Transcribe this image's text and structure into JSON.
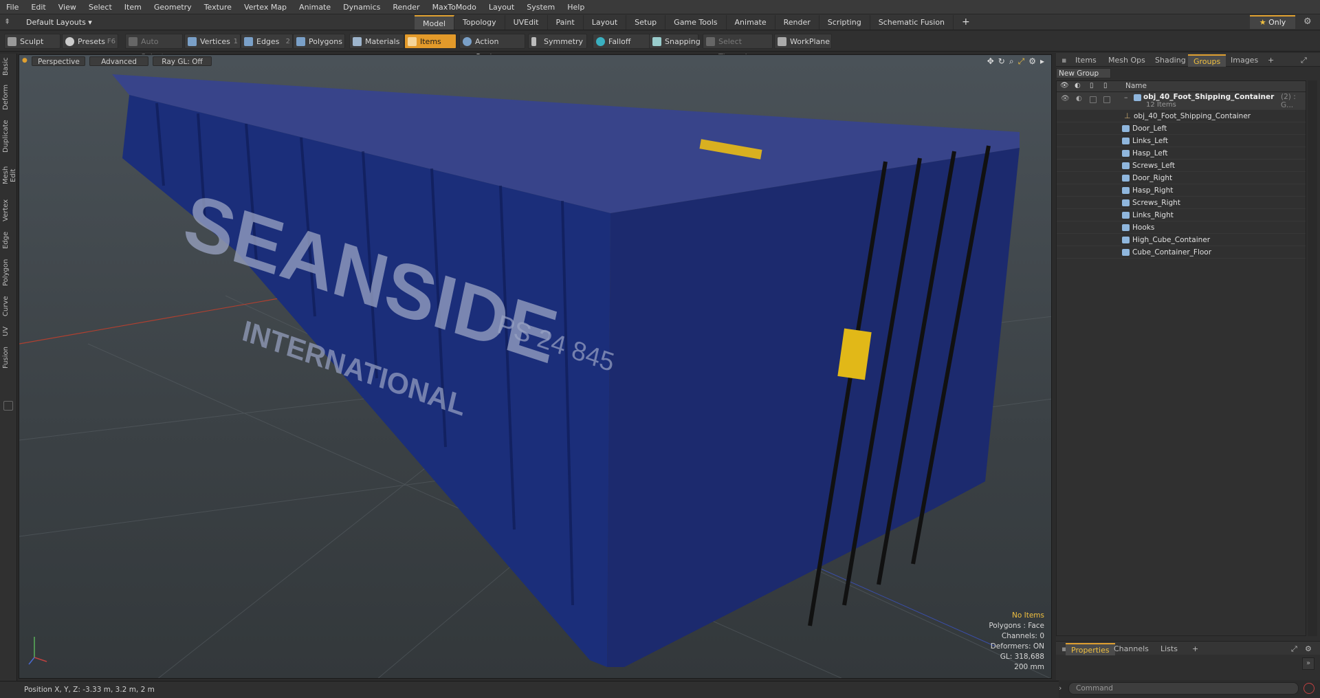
{
  "menu": [
    "File",
    "Edit",
    "View",
    "Select",
    "Item",
    "Geometry",
    "Texture",
    "Vertex Map",
    "Animate",
    "Dynamics",
    "Render",
    "MaxToModo",
    "Layout",
    "System",
    "Help"
  ],
  "layouts_label": "Default Layouts ▾",
  "tabs": [
    "Model",
    "Topology",
    "UVEdit",
    "Paint",
    "Layout",
    "Setup",
    "Game Tools",
    "Animate",
    "Render",
    "Scripting",
    "Schematic Fusion"
  ],
  "only_label": "Only",
  "toolbar": {
    "sculpt": "Sculpt",
    "presets": "Presets",
    "presets_key": "F6",
    "auto_select": "Auto Select",
    "vertices": "Vertices",
    "vertices_key": "1",
    "edges": "Edges",
    "edges_key": "2",
    "polygons": "Polygons",
    "materials": "Materials",
    "items": "Items",
    "action_center": "Action Center",
    "symmetry": "Symmetry",
    "falloff": "Falloff",
    "snapping": "Snapping",
    "select_through": "Select Through",
    "workplane": "WorkPlane"
  },
  "left_tabs": [
    "Basic",
    "Deform",
    "Duplicate",
    "Mesh Edit",
    "Vertex",
    "Edge",
    "Polygon",
    "Curve",
    "UV",
    "Fusion"
  ],
  "viewport": {
    "perspective": "Perspective",
    "advanced": "Advanced",
    "raygl": "Ray GL: Off",
    "container_text": "SEANSIDE",
    "container_sub": "INTERNATIONAL",
    "container_code": "PS 24 845",
    "hud": {
      "no_items": "No Items",
      "polygons": "Polygons : Face",
      "channels": "Channels: 0",
      "deformers": "Deformers: ON",
      "gl": "GL: 318,688",
      "scale": "200 mm"
    }
  },
  "status": "Position X, Y, Z:  -3.33 m, 3.2 m, 2 m",
  "right_tabs": [
    "Items",
    "Mesh Ops",
    "Shading",
    "Groups",
    "Images"
  ],
  "new_group": "New Group",
  "grid_header_name": "Name",
  "group": {
    "name": "obj_40_Foot_Shipping_Container",
    "suffix": "(2) : G...",
    "count": "12 Items"
  },
  "items": [
    "obj_40_Foot_Shipping_Container",
    "Door_Left",
    "Links_Left",
    "Hasp_Left",
    "Screws_Left",
    "Door_Right",
    "Hasp_Right",
    "Screws_Right",
    "Links_Right",
    "Hooks",
    "High_Cube_Container",
    "Cube_Container_Floor"
  ],
  "bottom_tabs": [
    "Properties",
    "Channels",
    "Lists"
  ],
  "command_placeholder": "Command"
}
